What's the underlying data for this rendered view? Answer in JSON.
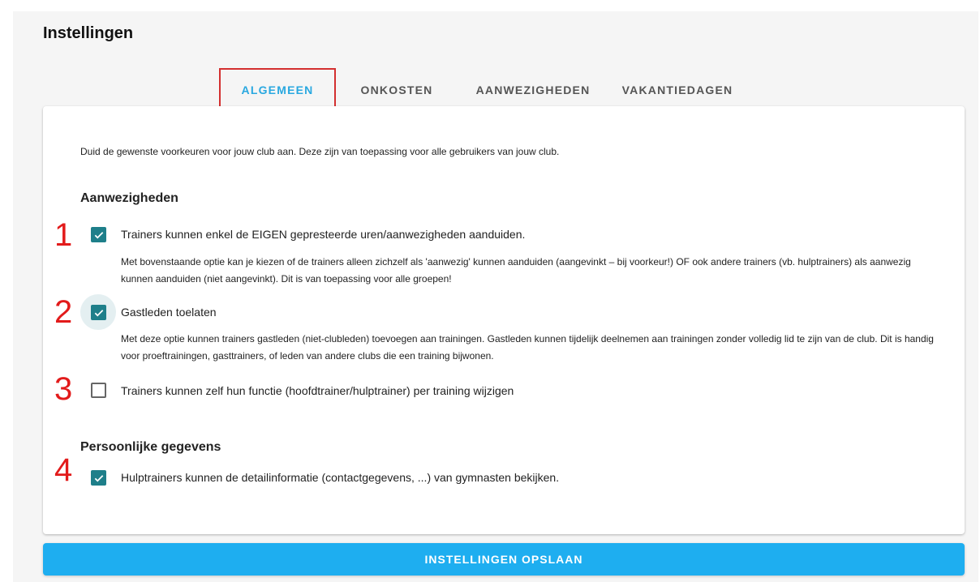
{
  "page": {
    "title": "Instellingen"
  },
  "tabs": [
    {
      "label": "ALGEMEEN",
      "active": true
    },
    {
      "label": "ONKOSTEN",
      "active": false
    },
    {
      "label": "AANWEZIGHEDEN",
      "active": false
    },
    {
      "label": "VAKANTIEDAGEN",
      "active": false
    }
  ],
  "intro": "Duid de gewenste voorkeuren voor jouw club aan. Deze zijn van toepassing voor alle gebruikers van jouw club.",
  "sections": {
    "attendance": {
      "title": "Aanwezigheden",
      "options": [
        {
          "marker": "1",
          "checked": true,
          "label": "Trainers kunnen enkel de EIGEN gepresteerde uren/aanwezigheden aanduiden.",
          "description": "Met bovenstaande optie kan je kiezen of de trainers alleen zichzelf als 'aanwezig' kunnen aanduiden (aangevinkt – bij voorkeur!) OF ook andere trainers (vb. hulptrainers) als aanwezig kunnen aanduiden (niet aangevinkt). Dit is van toepassing voor alle groepen!"
        },
        {
          "marker": "2",
          "checked": true,
          "label": "Gastleden toelaten",
          "description": "Met deze optie kunnen trainers gastleden (niet-clubleden) toevoegen aan trainingen. Gastleden kunnen tijdelijk deelnemen aan trainingen zonder volledig lid te zijn van de club. Dit is handig voor proeftrainingen, gasttrainers, of leden van andere clubs die een training bijwonen."
        },
        {
          "marker": "3",
          "checked": false,
          "label": "Trainers kunnen zelf hun functie (hoofdtrainer/hulptrainer) per training wijzigen"
        }
      ]
    },
    "personal": {
      "title": "Persoonlijke gegevens",
      "options": [
        {
          "marker": "4",
          "checked": true,
          "label": "Hulptrainers kunnen de detailinformatie (contactgegevens, ...) van gymnasten bekijken."
        }
      ]
    }
  },
  "save_button": {
    "label": "INSTELLINGEN OPSLAAN"
  },
  "colors": {
    "accent": "#1eaef0",
    "checkbox": "#1e7f8a",
    "marker": "#e21b1b",
    "highlight_border": "#d32f2f"
  }
}
